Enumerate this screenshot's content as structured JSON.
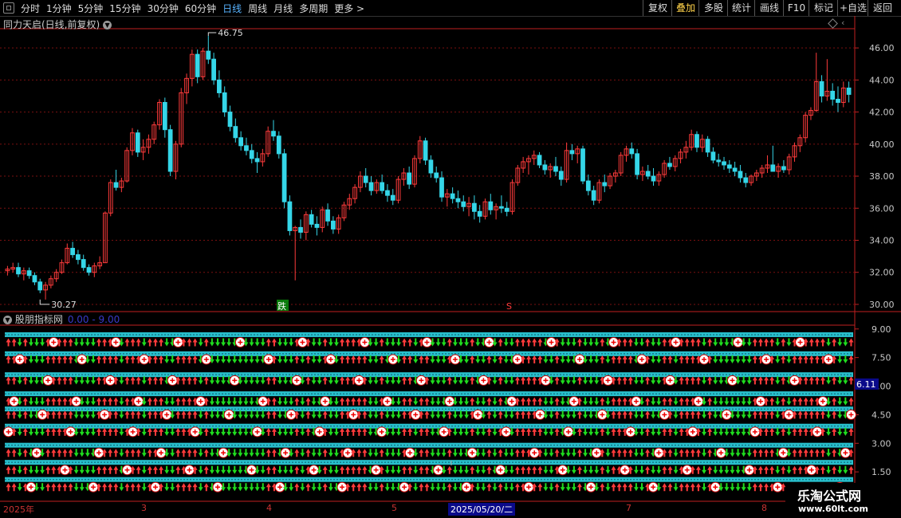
{
  "toolbar": {
    "periods": [
      "分时",
      "1分钟",
      "5分钟",
      "15分钟",
      "30分钟",
      "60分钟",
      "日线",
      "周线",
      "月线",
      "多周期",
      "更多 >"
    ],
    "active_period": "日线",
    "right_buttons": [
      "复权",
      "叠加",
      "多股",
      "统计",
      "画线",
      "F10",
      "标记",
      "+自选",
      "返回"
    ],
    "active_right": "叠加"
  },
  "main_title": "同力天启(日线,前复权)",
  "indicator_title": "股朋指标网",
  "indicator_range": "0.00 - 9.00",
  "price_axis": [
    "46.00",
    "44.00",
    "42.00",
    "40.00",
    "38.00",
    "36.00",
    "34.00",
    "32.00",
    "30.00"
  ],
  "indicator_axis": [
    "9.00",
    "7.50",
    "6.00",
    "4.50",
    "3.00",
    "1.50"
  ],
  "cursor_value": "6.11",
  "high_label": "46.75",
  "low_label": "30.27",
  "signal_fall": "跌",
  "signal_s": "S",
  "dates": [
    "2025年",
    "3",
    "4",
    "5",
    "2025/05/20/二",
    "7",
    "8"
  ],
  "watermark": {
    "line1": "乐淘公式网",
    "line2": "www.60lt.com"
  },
  "colors": {
    "up": "#ff3b3b",
    "down": "#35d6e8",
    "grid": "#7a1010",
    "axis": "#c02020",
    "green": "#1fdc1f",
    "cyan": "#2fe0f0"
  },
  "chart_data": {
    "type": "candlestick",
    "ylim": [
      29.5,
      47.2
    ],
    "candles": [
      [
        32.1,
        32.4,
        31.8,
        32.2
      ],
      [
        32.2,
        32.6,
        32.0,
        32.3
      ],
      [
        32.3,
        32.6,
        31.7,
        31.9
      ],
      [
        31.9,
        32.3,
        31.5,
        32.1
      ],
      [
        32.1,
        32.3,
        31.6,
        31.8
      ],
      [
        31.8,
        32.0,
        31.2,
        31.4
      ],
      [
        31.4,
        31.6,
        30.7,
        30.9
      ],
      [
        30.9,
        31.4,
        30.3,
        31.2
      ],
      [
        31.2,
        31.8,
        31.0,
        31.6
      ],
      [
        31.6,
        32.2,
        31.4,
        32.0
      ],
      [
        32.0,
        32.8,
        31.9,
        32.6
      ],
      [
        32.6,
        33.8,
        32.5,
        33.5
      ],
      [
        33.5,
        33.9,
        32.9,
        33.1
      ],
      [
        33.1,
        33.4,
        32.5,
        32.8
      ],
      [
        32.8,
        33.1,
        32.1,
        32.3
      ],
      [
        32.3,
        32.5,
        31.8,
        32.0
      ],
      [
        32.0,
        32.6,
        31.7,
        32.4
      ],
      [
        32.4,
        33.0,
        32.2,
        32.6
      ],
      [
        32.6,
        35.8,
        32.6,
        35.7
      ],
      [
        35.7,
        37.8,
        35.5,
        37.6
      ],
      [
        37.6,
        38.4,
        37.1,
        37.3
      ],
      [
        37.3,
        37.9,
        37.0,
        37.7
      ],
      [
        37.7,
        39.8,
        37.6,
        39.6
      ],
      [
        39.6,
        41.0,
        39.3,
        40.7
      ],
      [
        40.7,
        40.9,
        39.2,
        39.5
      ],
      [
        39.5,
        40.3,
        39.0,
        39.8
      ],
      [
        39.8,
        40.6,
        39.4,
        40.3
      ],
      [
        40.3,
        41.4,
        40.0,
        41.2
      ],
      [
        41.2,
        42.8,
        40.9,
        42.6
      ],
      [
        42.6,
        42.9,
        40.4,
        40.9
      ],
      [
        40.9,
        41.2,
        38.0,
        38.3
      ],
      [
        38.3,
        40.2,
        37.8,
        40.0
      ],
      [
        40.0,
        43.5,
        39.8,
        43.2
      ],
      [
        43.2,
        44.4,
        42.5,
        44.1
      ],
      [
        44.1,
        45.9,
        43.6,
        45.6
      ],
      [
        45.6,
        45.9,
        43.8,
        44.2
      ],
      [
        44.2,
        46.0,
        44.0,
        45.8
      ],
      [
        45.8,
        46.75,
        45.0,
        45.3
      ],
      [
        45.3,
        45.7,
        43.7,
        44.0
      ],
      [
        44.0,
        44.6,
        42.9,
        43.2
      ],
      [
        43.2,
        43.6,
        41.7,
        42.0
      ],
      [
        42.0,
        42.4,
        40.8,
        41.1
      ],
      [
        41.1,
        41.6,
        40.1,
        40.4
      ],
      [
        40.4,
        40.8,
        39.6,
        39.9
      ],
      [
        39.9,
        40.4,
        39.3,
        39.6
      ],
      [
        39.6,
        40.0,
        38.8,
        39.1
      ],
      [
        39.1,
        39.5,
        38.2,
        38.9
      ],
      [
        38.9,
        39.7,
        38.6,
        39.4
      ],
      [
        39.4,
        41.1,
        39.2,
        40.8
      ],
      [
        40.8,
        41.5,
        40.2,
        40.5
      ],
      [
        40.5,
        40.8,
        39.1,
        39.4
      ],
      [
        39.4,
        39.7,
        36.0,
        36.4
      ],
      [
        36.4,
        36.8,
        34.3,
        34.6
      ],
      [
        34.6,
        34.9,
        31.5,
        34.8
      ],
      [
        34.8,
        35.3,
        34.1,
        34.5
      ],
      [
        34.5,
        35.8,
        34.0,
        35.6
      ],
      [
        35.6,
        35.9,
        34.8,
        35.0
      ],
      [
        35.0,
        35.5,
        34.3,
        34.8
      ],
      [
        34.8,
        36.1,
        34.5,
        35.9
      ],
      [
        35.9,
        36.3,
        34.9,
        35.2
      ],
      [
        35.2,
        35.5,
        34.4,
        34.7
      ],
      [
        34.7,
        35.6,
        34.4,
        35.4
      ],
      [
        35.4,
        36.4,
        35.2,
        36.2
      ],
      [
        36.2,
        36.9,
        35.9,
        36.6
      ],
      [
        36.6,
        37.5,
        36.3,
        37.3
      ],
      [
        37.3,
        38.3,
        37.0,
        38.0
      ],
      [
        38.0,
        38.5,
        37.3,
        37.6
      ],
      [
        37.6,
        38.0,
        36.8,
        37.1
      ],
      [
        37.1,
        37.8,
        36.9,
        37.6
      ],
      [
        37.6,
        38.1,
        36.9,
        37.1
      ],
      [
        37.1,
        37.5,
        36.4,
        36.8
      ],
      [
        36.8,
        37.2,
        36.2,
        36.5
      ],
      [
        36.5,
        38.0,
        36.3,
        37.8
      ],
      [
        37.8,
        38.5,
        37.4,
        38.2
      ],
      [
        38.2,
        38.6,
        37.2,
        37.5
      ],
      [
        37.5,
        39.3,
        37.3,
        39.1
      ],
      [
        39.1,
        40.5,
        38.8,
        40.2
      ],
      [
        40.2,
        40.4,
        38.7,
        39.0
      ],
      [
        39.0,
        39.3,
        37.9,
        38.2
      ],
      [
        38.2,
        38.6,
        37.6,
        37.9
      ],
      [
        37.9,
        38.3,
        36.4,
        36.7
      ],
      [
        36.7,
        37.2,
        36.1,
        36.9
      ],
      [
        36.9,
        37.3,
        36.3,
        36.6
      ],
      [
        36.6,
        37.1,
        36.0,
        36.4
      ],
      [
        36.4,
        36.8,
        35.8,
        36.1
      ],
      [
        36.1,
        36.7,
        35.5,
        36.3
      ],
      [
        36.3,
        36.8,
        35.3,
        35.8
      ],
      [
        35.8,
        36.2,
        35.1,
        35.5
      ],
      [
        35.5,
        36.6,
        35.3,
        36.4
      ],
      [
        36.4,
        36.9,
        35.6,
        35.9
      ],
      [
        35.9,
        36.3,
        35.3,
        36.1
      ],
      [
        36.1,
        36.8,
        35.7,
        36.0
      ],
      [
        36.0,
        36.4,
        35.5,
        35.8
      ],
      [
        35.8,
        37.8,
        35.6,
        37.6
      ],
      [
        37.6,
        38.7,
        37.4,
        38.5
      ],
      [
        38.5,
        39.2,
        38.2,
        38.9
      ],
      [
        38.9,
        39.3,
        38.1,
        39.1
      ],
      [
        39.1,
        39.6,
        38.7,
        39.3
      ],
      [
        39.3,
        39.5,
        38.5,
        38.7
      ],
      [
        38.7,
        39.0,
        38.1,
        38.4
      ],
      [
        38.4,
        38.8,
        37.9,
        38.6
      ],
      [
        38.6,
        39.2,
        38.0,
        38.3
      ],
      [
        38.3,
        38.6,
        37.4,
        37.8
      ],
      [
        37.8,
        40.1,
        37.6,
        39.6
      ],
      [
        39.6,
        40.0,
        39.0,
        39.4
      ],
      [
        39.4,
        39.9,
        38.8,
        39.7
      ],
      [
        39.7,
        39.9,
        37.5,
        37.7
      ],
      [
        37.7,
        38.1,
        36.8,
        37.1
      ],
      [
        37.1,
        37.4,
        36.2,
        36.5
      ],
      [
        36.5,
        37.8,
        36.3,
        37.6
      ],
      [
        37.6,
        38.1,
        37.0,
        37.4
      ],
      [
        37.4,
        38.2,
        37.2,
        38.0
      ],
      [
        38.0,
        38.4,
        37.6,
        38.2
      ],
      [
        38.2,
        39.5,
        38.0,
        39.3
      ],
      [
        39.3,
        39.9,
        38.9,
        39.7
      ],
      [
        39.7,
        40.1,
        39.1,
        39.4
      ],
      [
        39.4,
        39.7,
        37.8,
        38.1
      ],
      [
        38.1,
        38.6,
        37.7,
        38.3
      ],
      [
        38.3,
        38.7,
        37.8,
        38.0
      ],
      [
        38.0,
        38.5,
        37.4,
        37.7
      ],
      [
        37.7,
        38.3,
        37.4,
        38.1
      ],
      [
        38.1,
        39.0,
        37.9,
        38.8
      ],
      [
        38.8,
        39.2,
        38.4,
        38.6
      ],
      [
        38.6,
        39.3,
        38.3,
        39.1
      ],
      [
        39.1,
        39.7,
        38.8,
        39.5
      ],
      [
        39.5,
        40.2,
        39.1,
        39.8
      ],
      [
        39.8,
        40.9,
        39.6,
        40.6
      ],
      [
        40.6,
        40.8,
        39.5,
        39.8
      ],
      [
        39.8,
        40.6,
        39.5,
        40.3
      ],
      [
        40.3,
        40.5,
        39.2,
        39.5
      ],
      [
        39.5,
        39.8,
        38.8,
        39.0
      ],
      [
        39.0,
        39.4,
        38.6,
        38.9
      ],
      [
        38.9,
        39.2,
        38.4,
        38.7
      ],
      [
        38.7,
        39.0,
        38.2,
        38.5
      ],
      [
        38.5,
        38.9,
        38.0,
        38.3
      ],
      [
        38.3,
        38.7,
        37.6,
        37.9
      ],
      [
        37.9,
        38.2,
        37.3,
        37.6
      ],
      [
        37.6,
        38.1,
        37.4,
        38.0
      ],
      [
        38.0,
        38.4,
        37.7,
        38.2
      ],
      [
        38.2,
        38.7,
        37.9,
        38.5
      ],
      [
        38.5,
        39.3,
        38.2,
        38.7
      ],
      [
        38.7,
        39.9,
        38.5,
        38.3
      ],
      [
        38.3,
        38.8,
        37.9,
        38.6
      ],
      [
        38.6,
        39.0,
        38.2,
        38.4
      ],
      [
        38.4,
        39.4,
        38.1,
        39.2
      ],
      [
        39.2,
        40.1,
        38.9,
        39.9
      ],
      [
        39.9,
        40.6,
        39.5,
        40.4
      ],
      [
        40.4,
        42.0,
        40.1,
        41.8
      ],
      [
        41.8,
        42.3,
        41.5,
        42.1
      ],
      [
        42.1,
        45.7,
        42.0,
        43.9
      ],
      [
        43.9,
        44.3,
        42.6,
        43.0
      ],
      [
        43.0,
        45.3,
        42.7,
        43.3
      ],
      [
        43.3,
        43.8,
        42.4,
        42.8
      ],
      [
        42.8,
        43.6,
        42.0,
        42.6
      ],
      [
        42.6,
        43.9,
        42.3,
        43.5
      ],
      [
        43.5,
        43.9,
        42.6,
        43.1
      ]
    ],
    "indicator_rows": [
      {
        "y": 8.7,
        "tag": "lbl"
      },
      {
        "y": 8.3,
        "tag": "arrows"
      },
      {
        "y": 7.7,
        "tag": "lbl"
      },
      {
        "y": 7.4,
        "tag": "arrows"
      },
      {
        "y": 6.6,
        "tag": "lbl"
      },
      {
        "y": 6.3,
        "tag": "arrows"
      },
      {
        "y": 5.6,
        "tag": "lbl"
      },
      {
        "y": 5.2,
        "tag": "arrows"
      },
      {
        "y": 4.8,
        "tag": "lbl"
      },
      {
        "y": 4.5,
        "tag": "arrows"
      },
      {
        "y": 3.9,
        "tag": "lbl"
      },
      {
        "y": 3.6,
        "tag": "arrows"
      },
      {
        "y": 2.9,
        "tag": "lbl"
      },
      {
        "y": 2.5,
        "tag": "arrows"
      },
      {
        "y": 2.0,
        "tag": "lbl"
      },
      {
        "y": 1.6,
        "tag": "arrows"
      },
      {
        "y": 1.1,
        "tag": "lbl"
      },
      {
        "y": 0.7,
        "tag": "arrows"
      }
    ]
  }
}
